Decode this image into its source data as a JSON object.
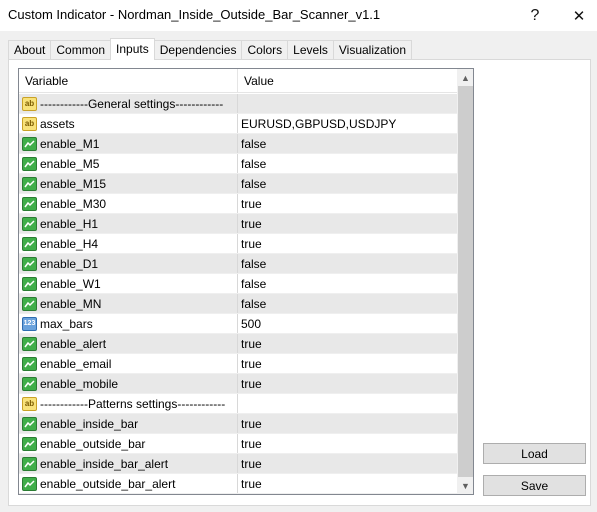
{
  "window": {
    "title": "Custom Indicator - Nordman_Inside_Outside_Bar_Scanner_v1.1",
    "help_glyph": "?",
    "close_glyph": "✕"
  },
  "tabs": [
    "About",
    "Common",
    "Inputs",
    "Dependencies",
    "Colors",
    "Levels",
    "Visualization"
  ],
  "active_tab": "Inputs",
  "grid": {
    "col_variable": "Variable",
    "col_value": "Value",
    "rows": [
      {
        "icon": "ab",
        "name": "------------General settings------------",
        "value": ""
      },
      {
        "icon": "ab",
        "name": "assets",
        "value": "EURUSD,GBPUSD,USDJPY"
      },
      {
        "icon": "bool",
        "name": "enable_M1",
        "value": "false"
      },
      {
        "icon": "bool",
        "name": "enable_M5",
        "value": "false"
      },
      {
        "icon": "bool",
        "name": "enable_M15",
        "value": "false"
      },
      {
        "icon": "bool",
        "name": "enable_M30",
        "value": "true"
      },
      {
        "icon": "bool",
        "name": "enable_H1",
        "value": "true"
      },
      {
        "icon": "bool",
        "name": "enable_H4",
        "value": "true"
      },
      {
        "icon": "bool",
        "name": "enable_D1",
        "value": "false"
      },
      {
        "icon": "bool",
        "name": "enable_W1",
        "value": "false"
      },
      {
        "icon": "bool",
        "name": "enable_MN",
        "value": "false"
      },
      {
        "icon": "num",
        "name": "max_bars",
        "value": "500"
      },
      {
        "icon": "bool",
        "name": "enable_alert",
        "value": "true"
      },
      {
        "icon": "bool",
        "name": "enable_email",
        "value": "true"
      },
      {
        "icon": "bool",
        "name": "enable_mobile",
        "value": "true"
      },
      {
        "icon": "ab",
        "name": "------------Patterns settings------------",
        "value": ""
      },
      {
        "icon": "bool",
        "name": "enable_inside_bar",
        "value": "true"
      },
      {
        "icon": "bool",
        "name": "enable_outside_bar",
        "value": "true"
      },
      {
        "icon": "bool",
        "name": "enable_inside_bar_alert",
        "value": "true"
      },
      {
        "icon": "bool",
        "name": "enable_outside_bar_alert",
        "value": "true"
      }
    ]
  },
  "buttons": {
    "load": "Load",
    "save": "Save"
  },
  "icons": {
    "ab": "ab",
    "num": "123"
  }
}
